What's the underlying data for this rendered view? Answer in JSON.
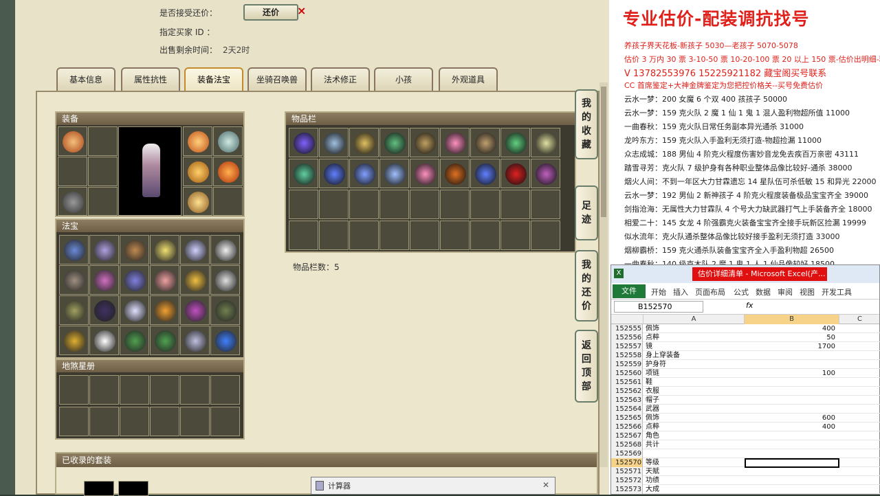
{
  "game": {
    "accept_offer_label": "是否接受还价：",
    "offer_button": "还价",
    "offer_close": "×",
    "buyer_id_label": "指定买家 ID ：",
    "time_left_label": "出售剩余时间：",
    "time_left_value": "2天2时",
    "tabs": [
      "基本信息",
      "属性抗性",
      "装备法宝",
      "坐骑召唤兽",
      "法术修正",
      "小孩",
      "外观道具"
    ],
    "active_tab": "装备法宝",
    "sections": {
      "equipment": "装备",
      "treasure": "法宝",
      "item_bar": "物品栏",
      "map_register": "地煞星册",
      "collected_sets": "已收录的套装"
    },
    "item_count_label": "物品栏数：5",
    "side_buttons": [
      {
        "label": "我的收藏"
      },
      {
        "label": "足迹"
      },
      {
        "label": "我的还价"
      },
      {
        "label": "返回顶部"
      }
    ],
    "calculator_title": "计算器",
    "calculator_close": "✕"
  },
  "right_panel": {
    "headline": "专业估价-配装调抗找号",
    "red_lines": [
      "养孩子界天花板-新孩子 5030—老孩子 5070-5078",
      "估价 3 万内 30 票 3-10-50 票 10-20-100 票 20 以上 150 票-估价出明细-精准",
      "V 13782553976   15225921182  藏宝阁买号联系",
      "CC 首席鉴定+大神金牌鉴定为您把控价格关--买号免费估价"
    ],
    "black_lines": [
      "云水一梦：200 女魔 6 个双 400 孩孩子 50000",
      "云水一梦：159 克火队 2 魔 1 仙 1 鬼 1 混人盈利物超所值 11000",
      "一曲春秋：159 克火队日常任务副本异光通杀 31000",
      "龙吟东方：159 克火队入手盈利无须打造-物超捡漏 11000",
      "众志成城：188 男仙 4 阶克火程度伤害妙音龙免去疾百万亲密 43111",
      "踏雪寻芳：克火队 7 级护身有各种职业整体品像比较好-通杀 38000",
      "烟火人间：不到一年区大力甘霖遗忘 14 星队伍可杀低敏 15 和异光 22000",
      "云水一梦：192 男仙 2 新神孩子 4 阶克火程度装备极品宝宝齐全 39000",
      "剑指沧海：无属性大力甘霖队 4 个号大力缺武器打气上手装备齐全 18000",
      "相爱二十：145 女龙 4 阶强霸克火装备宝宝齐全接手玩新区捡漏 19999",
      "似水流年：克火队通杀整体品像比较好接手盈利无须打造 33000",
      "烟柳霸桥：159 克火通杀队装备宝宝齐全入手盈利物超 26500",
      "一曲春秋：140 级克木队 2 魔 1 鬼 1 人 1 仙品像较好 18500"
    ]
  },
  "excel": {
    "title": "估价详细清单 - Microsoft Excel(产...",
    "ribbon_tabs": [
      "文件",
      "开始",
      "插入",
      "页面布局",
      "公式",
      "数据",
      "审阅",
      "视图",
      "开发工具"
    ],
    "name_box": "B152570",
    "fx": "fx",
    "columns": [
      "A",
      "B",
      "C"
    ],
    "rows": [
      {
        "n": "152555",
        "a": "佩饰",
        "b": "400"
      },
      {
        "n": "152556",
        "a": "点粹",
        "b": "50"
      },
      {
        "n": "152557",
        "a": "镜",
        "b": "1700"
      },
      {
        "n": "152558",
        "a": "身上穿装备",
        "b": ""
      },
      {
        "n": "152559",
        "a": "护身符",
        "b": ""
      },
      {
        "n": "152560",
        "a": "项链",
        "b": "100"
      },
      {
        "n": "152561",
        "a": "鞋",
        "b": ""
      },
      {
        "n": "152562",
        "a": "衣服",
        "b": ""
      },
      {
        "n": "152563",
        "a": "帽子",
        "b": ""
      },
      {
        "n": "152564",
        "a": "武器",
        "b": ""
      },
      {
        "n": "152565",
        "a": "佩饰",
        "b": "600"
      },
      {
        "n": "152566",
        "a": "点粹",
        "b": "400"
      },
      {
        "n": "152567",
        "a": "角色",
        "b": ""
      },
      {
        "n": "152568",
        "a": "共计",
        "b": ""
      },
      {
        "n": "152569",
        "a": "",
        "b": ""
      },
      {
        "n": "152570",
        "a": "等级",
        "b": ""
      },
      {
        "n": "152571",
        "a": "天赋",
        "b": ""
      },
      {
        "n": "152572",
        "a": "功绩",
        "b": ""
      },
      {
        "n": "152573",
        "a": "大成",
        "b": ""
      }
    ],
    "selected_row": "152570"
  },
  "colors": {
    "headline_red": "#e0201a",
    "excel_green": "#1f7a3a",
    "tab_active_border": "#c28a2a"
  }
}
